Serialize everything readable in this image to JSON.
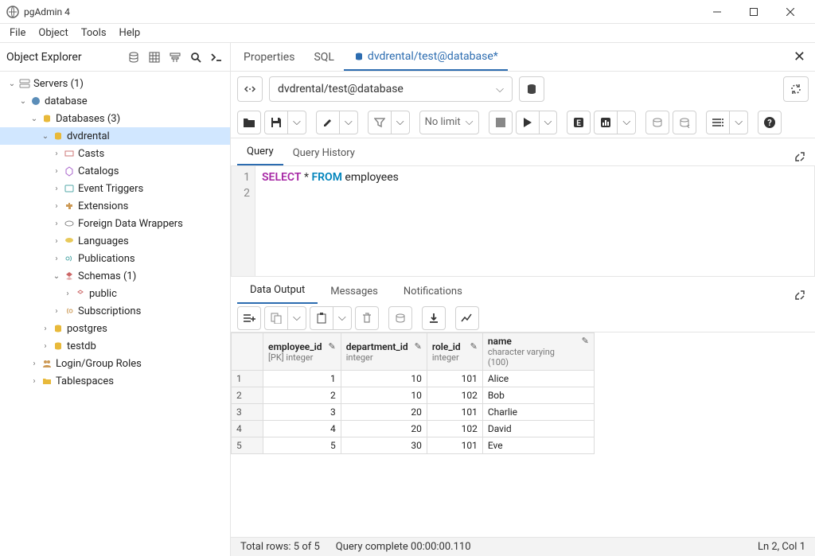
{
  "window": {
    "title": "pgAdmin 4"
  },
  "menu": {
    "file": "File",
    "object": "Object",
    "tools": "Tools",
    "help": "Help"
  },
  "explorer": {
    "title": "Object Explorer"
  },
  "tree": {
    "servers": "Servers (1)",
    "database_group": "database",
    "databases": "Databases (3)",
    "dvdrental": "dvdrental",
    "casts": "Casts",
    "catalogs": "Catalogs",
    "event_triggers": "Event Triggers",
    "extensions": "Extensions",
    "fdw": "Foreign Data Wrappers",
    "languages": "Languages",
    "publications": "Publications",
    "schemas": "Schemas (1)",
    "public": "public",
    "subscriptions": "Subscriptions",
    "postgres": "postgres",
    "testdb": "testdb",
    "login_roles": "Login/Group Roles",
    "tablespaces": "Tablespaces"
  },
  "tabs": {
    "properties": "Properties",
    "sql": "SQL",
    "query_tool": "dvdrental/test@database*"
  },
  "connection": {
    "active": "dvdrental/test@database"
  },
  "toolbar": {
    "nolimit": "No limit"
  },
  "query_tabs": {
    "query": "Query",
    "history": "Query History"
  },
  "sql": {
    "line1_kw1": "SELECT",
    "line1_op": " * ",
    "line1_kw2": "FROM",
    "line1_rest": " employees"
  },
  "output_tabs": {
    "data": "Data Output",
    "messages": "Messages",
    "notifications": "Notifications"
  },
  "columns": [
    {
      "name": "employee_id",
      "type": "[PK] integer"
    },
    {
      "name": "department_id",
      "type": "integer"
    },
    {
      "name": "role_id",
      "type": "integer"
    },
    {
      "name": "name",
      "type": "character varying (100)"
    }
  ],
  "rows": [
    {
      "n": "1",
      "employee_id": "1",
      "department_id": "10",
      "role_id": "101",
      "name": "Alice"
    },
    {
      "n": "2",
      "employee_id": "2",
      "department_id": "10",
      "role_id": "102",
      "name": "Bob"
    },
    {
      "n": "3",
      "employee_id": "3",
      "department_id": "20",
      "role_id": "101",
      "name": "Charlie"
    },
    {
      "n": "4",
      "employee_id": "4",
      "department_id": "20",
      "role_id": "102",
      "name": "David"
    },
    {
      "n": "5",
      "employee_id": "5",
      "department_id": "30",
      "role_id": "101",
      "name": "Eve"
    }
  ],
  "status": {
    "total_rows": "Total rows: 5 of 5",
    "query_complete": "Query complete 00:00:00.110",
    "cursor": "Ln 2, Col 1"
  }
}
